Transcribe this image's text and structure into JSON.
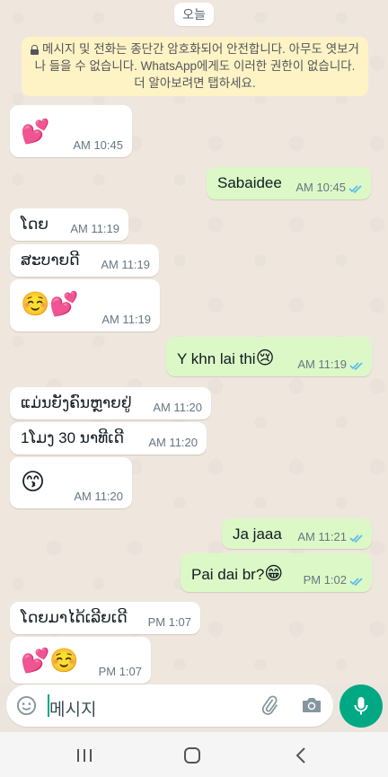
{
  "date_chip": "오늘",
  "notice": "메시지 및 전화는 종단간 암호화되어 안전합니다. 아무도 엿보거나 들을 수 없습니다. WhatsApp에게도 이러한 권한이 없습니다. 더 알아보려면 탭하세요.",
  "messages": [
    {
      "dir": "in",
      "text": "💕",
      "time": "AM 10:45"
    },
    {
      "dir": "out",
      "text": "Sabaidee",
      "time": "AM 10:45",
      "status": "read"
    },
    {
      "dir": "in",
      "text": "ໂດຍ",
      "time": "AM 11:19"
    },
    {
      "dir": "in",
      "text": "ສະບາຍດີ",
      "time": "AM 11:19"
    },
    {
      "dir": "in",
      "text": "☺️💕",
      "time": "AM 11:19"
    },
    {
      "dir": "out",
      "text": "Y khn lai thi",
      "emoji": "😢",
      "time": "AM 11:19",
      "status": "read"
    },
    {
      "dir": "in",
      "text": "ແມ່ນຍັງຄົນຫຼາຍຢູ່",
      "time": "AM 11:20"
    },
    {
      "dir": "in",
      "text": "1ໂມງ 30 ນາທີເດີ",
      "time": "AM 11:20"
    },
    {
      "dir": "in",
      "text": "😙",
      "time": "AM 11:20"
    },
    {
      "dir": "out",
      "text": "Ja jaaa",
      "time": "AM 11:21",
      "status": "read"
    },
    {
      "dir": "out",
      "text": "Pai dai br?",
      "emoji": "😁",
      "time": "PM 1:02",
      "status": "read"
    },
    {
      "dir": "in",
      "text": "ໂດຍມາໄດ້ເລີຍເດີ",
      "time": "PM 1:07"
    },
    {
      "dir": "in",
      "text": "💕☺️",
      "time": "PM 1:07"
    }
  ],
  "composer": {
    "placeholder": "메시지"
  },
  "colors": {
    "accent": "#00a884",
    "outgoing_bubble": "#dcf8c6",
    "read_tick": "#53bdeb"
  },
  "icons": [
    "emoji-icon",
    "attach-icon",
    "camera-icon",
    "mic-icon",
    "nav-recent-icon",
    "nav-home-icon",
    "nav-back-icon"
  ]
}
